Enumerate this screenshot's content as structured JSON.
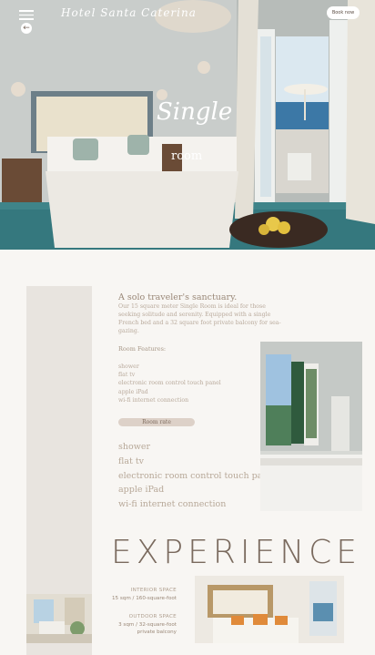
{
  "header": {
    "brand": "Hotel Santa Caterina",
    "book_label": "Book now"
  },
  "hero": {
    "title": "Single",
    "subtitle": "room"
  },
  "intro": {
    "title": "A solo traveler's sanctuary.",
    "text": "Our 15 square meter Single Room is ideal for those seeking solitude and serenity. Equipped with a single French bed and a 32 square foot private balcony for sea-gazing."
  },
  "features": {
    "heading": "Room Features:",
    "items": [
      "shower",
      "flat tv",
      "electronic room control touch panel",
      "apple iPad",
      "wi-fi internet connection"
    ]
  },
  "rate_label": "Room rate",
  "big_features": [
    "shower",
    "flat tv",
    "electronic room control touch panel",
    "apple iPad",
    "wi-fi internet connection"
  ],
  "experience_title": "EXPERIENCE",
  "spaces": {
    "interior_label": "INTERIOR SPACE",
    "interior_value": "15 sqm / 160-square-foot",
    "outdoor_label": "OUTDOOR SPACE",
    "outdoor_value_1": "3 sqm / 32-square-foot",
    "outdoor_value_2": "private balcony"
  },
  "icons": {
    "menu": "menu-icon",
    "back": "arrow-left-icon"
  },
  "colors": {
    "accent": "#7a6a5e",
    "text_light": "#b9aa9c",
    "band": "#e8e4df"
  }
}
